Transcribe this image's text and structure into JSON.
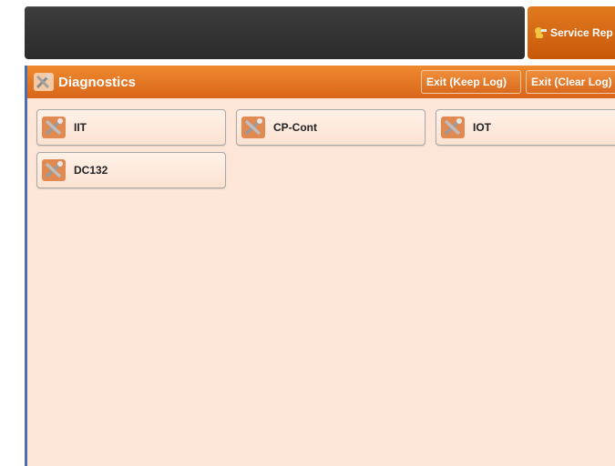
{
  "header": {
    "service_label": "Service Rep",
    "service_icon": "service-rep-icon"
  },
  "panel": {
    "title": "Diagnostics",
    "title_icon": "tools-icon",
    "exit_keep_label": "Exit (Keep Log)",
    "exit_clear_label": "Exit (Clear Log)"
  },
  "tiles": [
    {
      "label": "IIT",
      "icon": "tools-icon"
    },
    {
      "label": "CP-Cont",
      "icon": "tools-icon"
    },
    {
      "label": "IOT",
      "icon": "tools-icon"
    },
    {
      "label": "DC132",
      "icon": "tools-icon"
    }
  ],
  "colors": {
    "accent": "#d9651a",
    "panel_bg": "#fde6d8",
    "top_bar": "#333333"
  }
}
